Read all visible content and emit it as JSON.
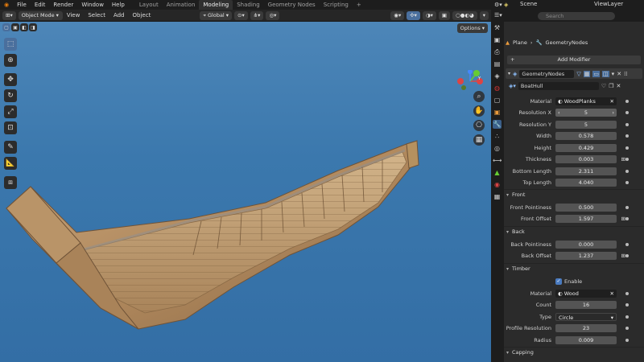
{
  "topbar": {
    "menus": [
      "File",
      "Edit",
      "Render",
      "Window",
      "Help"
    ],
    "workspaces": [
      "Layout",
      "Animation",
      "Modeling",
      "Shading",
      "Geometry Nodes",
      "Scripting"
    ],
    "active_workspace": "Modeling",
    "add_tab": "+",
    "scene": "Scene",
    "view_layer": "ViewLayer"
  },
  "viewport_header": {
    "mode": "Object Mode",
    "menus": [
      "View",
      "Select",
      "Add",
      "Object"
    ],
    "orientation": "Global",
    "options": "Options"
  },
  "properties": {
    "search_placeholder": "Search",
    "breadcrumb_object": "Plane",
    "breadcrumb_modifier": "GeometryNodes",
    "add_modifier": "Add Modifier",
    "modifier_name": "GeometryNodes",
    "node_group": "BoatHull",
    "fields": [
      {
        "label": "Material",
        "value": "WoodPlanks",
        "kind": "material"
      },
      {
        "label": "Resolution X",
        "value": "5",
        "kind": "stepper"
      },
      {
        "label": "Resolution Y",
        "value": "5",
        "kind": "num"
      },
      {
        "label": "Width",
        "value": "0.578",
        "kind": "num"
      },
      {
        "label": "Height",
        "value": "0.429",
        "kind": "num"
      },
      {
        "label": "Thickness",
        "value": "0.003",
        "kind": "numkey"
      },
      {
        "label": "Bottom Length",
        "value": "2.311",
        "kind": "num"
      },
      {
        "label": "Top Length",
        "value": "4.040",
        "kind": "num"
      }
    ],
    "section_front": "Front",
    "front_fields": [
      {
        "label": "Front Pointiness",
        "value": "0.500",
        "kind": "num"
      },
      {
        "label": "Front Offset",
        "value": "1.597",
        "kind": "numkey"
      }
    ],
    "section_back": "Back",
    "back_fields": [
      {
        "label": "Back Pointiness",
        "value": "0.000",
        "kind": "num"
      },
      {
        "label": "Back Offset",
        "value": "1.237",
        "kind": "numkey"
      }
    ],
    "section_timber": "Timber",
    "timber_enable": "Enable",
    "timber_fields": [
      {
        "label": "Material",
        "value": "Wood",
        "kind": "material"
      },
      {
        "label": "Count",
        "value": "16",
        "kind": "num"
      },
      {
        "label": "Type",
        "value": "Circle",
        "kind": "select"
      },
      {
        "label": "Profile Resolution",
        "value": "23",
        "kind": "num"
      },
      {
        "label": "Radius",
        "value": "0.009",
        "kind": "num"
      }
    ],
    "section_capping": "Capping"
  },
  "gizmo": {
    "x": "X",
    "y": "Y",
    "z": "Z"
  },
  "colors": {
    "accent": "#4a6f9d",
    "sky_top": "#4d86b8",
    "sky_bottom": "#336ea5",
    "wood": "#b8936a"
  }
}
